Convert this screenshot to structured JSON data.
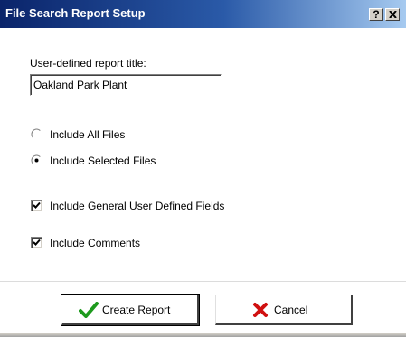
{
  "window": {
    "title": "File Search Report Setup",
    "help_label": "?",
    "close_icon": "close-icon"
  },
  "form": {
    "report_title_label": "User-defined report title:",
    "report_title_value": "Oakland Park Plant",
    "radio_all_label": "Include All Files",
    "radio_selected_label": "Include Selected Files",
    "selected_radio": "include-selected-files",
    "check_general_label": "Include General User Defined Fields",
    "check_general_checked": true,
    "check_comments_label": "Include Comments",
    "check_comments_checked": true
  },
  "buttons": {
    "create_label": "Create Report",
    "create_icon": "checkmark-icon",
    "cancel_label": "Cancel",
    "cancel_icon": "red-x-icon"
  },
  "colors": {
    "title_gradient_start": "#0a246a",
    "title_gradient_end": "#a6caf0",
    "check_green": "#1e9a1e",
    "cancel_red": "#d01010"
  }
}
